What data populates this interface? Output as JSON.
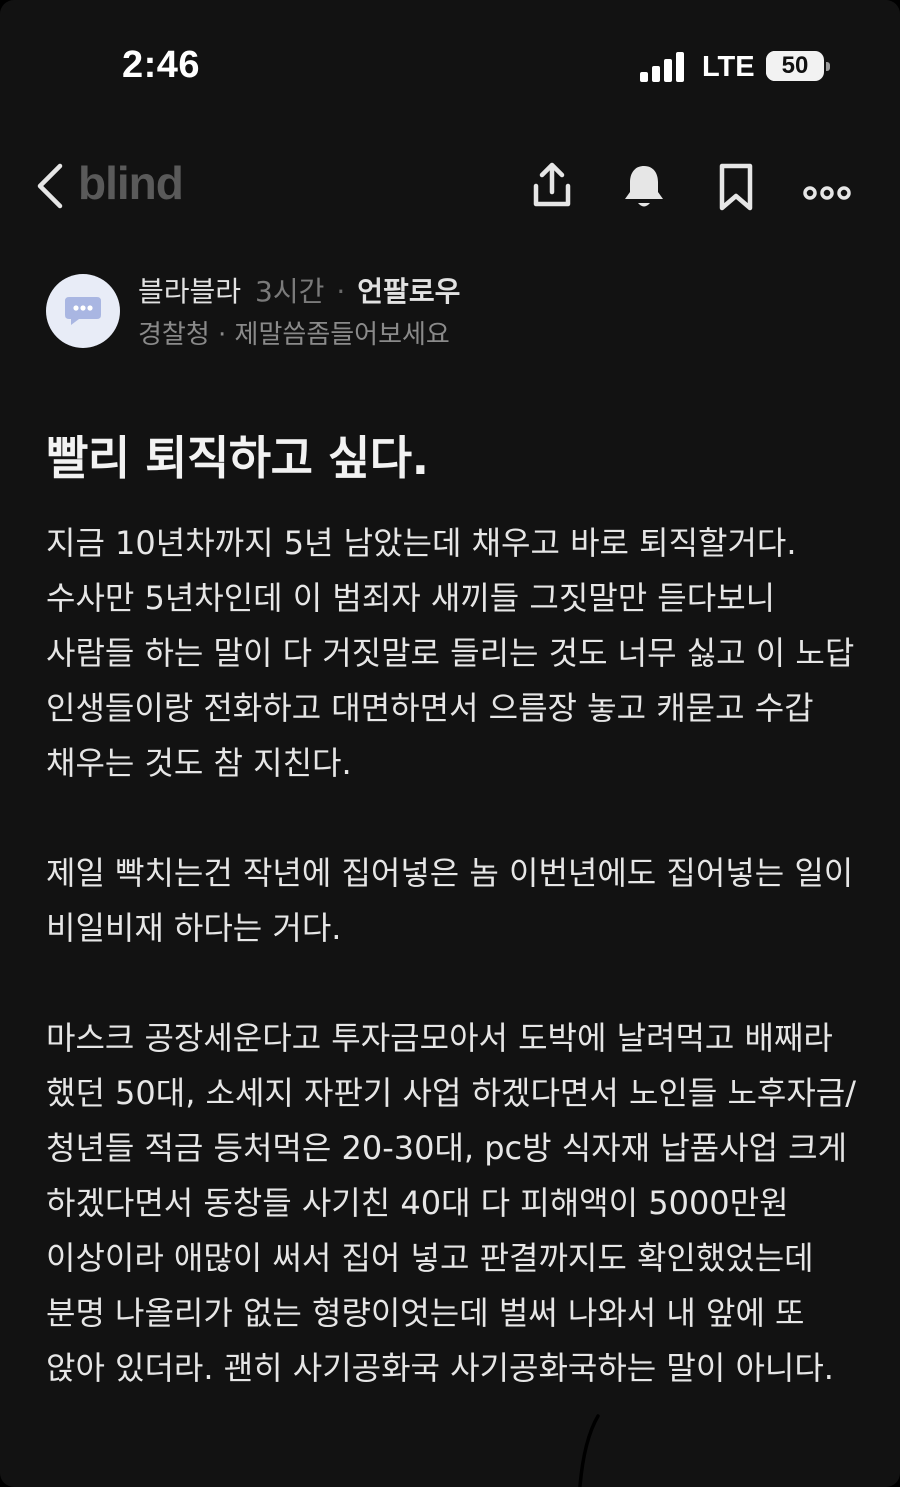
{
  "status_bar": {
    "time": "2:46",
    "network": "LTE",
    "battery": "50",
    "battery_level": 0.5
  },
  "nav": {
    "brand": "blind",
    "icons": [
      "back-chevron-icon",
      "share-icon",
      "bell-icon",
      "bookmark-icon",
      "more-icon"
    ]
  },
  "author": {
    "nickname": "블라블라",
    "time": "3시간",
    "separator": "·",
    "follow_label": "언팔로우",
    "org_line": "경찰청 · 제말씀좀들어보세요"
  },
  "post": {
    "title": "빨리 퇴직하고 싶다.",
    "paragraphs": [
      "지금 10년차까지 5년 남았는데 채우고 바로 퇴직할거다. 수사만 5년차인데 이 범죄자 새끼들 그짓말만 듣다보니 사람들 하는 말이 다 거짓말로 들리는 것도 너무 싫고 이 노답 인생들이랑 전화하고 대면하면서 으름장 놓고 캐묻고 수갑 채우는 것도 참 지친다.",
      "제일 빡치는건 작년에 집어넣은 놈 이번년에도 집어넣는 일이 비일비재 하다는 거다.",
      "마스크 공장세운다고 투자금모아서 도박에 날려먹고 배째라 했던 50대, 소세지 자판기 사업 하겠다면서 노인들 노후자금/청년들 적금 등처먹은 20-30대, pc방 식자재 납품사업 크게 하겠다면서 동창들 사기친 40대 다 피해액이 5000만원 이상이라 애많이 써서 집어 넣고 판결까지도 확인했었는데 분명 나올리가 없는 형량이엇는데 벌써 나와서 내 앞에 또 앉아 있더라. 괜히 사기공화국 사기공화국하는 말이 아니다."
    ]
  },
  "colors": {
    "background": "#121212",
    "text": "#e6e6e6",
    "muted": "#8a8a8a",
    "brand": "#5a5a5a",
    "avatar_bg": "#e8ecf7",
    "avatar_icon": "#a9b6e2"
  }
}
